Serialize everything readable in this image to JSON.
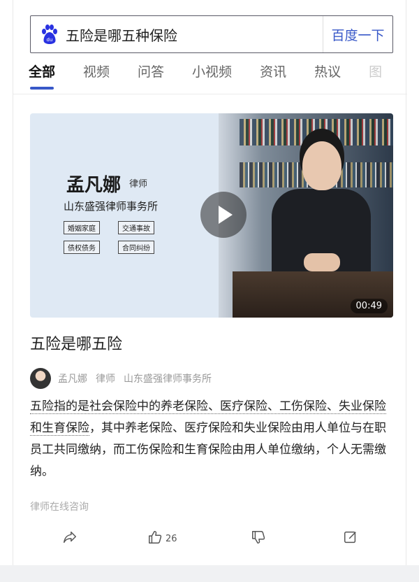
{
  "search": {
    "query": "五险是哪五种保险",
    "button_label": "百度一下"
  },
  "tabs": [
    {
      "label": "全部",
      "active": true
    },
    {
      "label": "视频"
    },
    {
      "label": "问答"
    },
    {
      "label": "小视频"
    },
    {
      "label": "资讯"
    },
    {
      "label": "热议"
    },
    {
      "label": "图"
    }
  ],
  "video": {
    "lawyer_name": "孟凡娜",
    "lawyer_role": "律师",
    "law_firm": "山东盛强律师事务所",
    "practice_tags": [
      "婚姻家庭",
      "交通事故",
      "债权债务",
      "合同纠纷"
    ],
    "duration": "00:49"
  },
  "result": {
    "title": "五险是哪五险",
    "author_name": "孟凡娜",
    "author_role": "律师",
    "author_firm": "山东盛强律师事务所",
    "body_highlight": "五险指的是社会保险中的养老保险、医疗保险、工伤保险、失业保险和生育保险",
    "body_rest": "，其中养老保险、医疗保险和失业保险由用人单位与在职员工共同缴纳，而工伤保险和生育保险由用人单位缴纳，个人无需缴纳。",
    "source": "律师在线咨询"
  },
  "actions": {
    "like_count": "26"
  },
  "icons": [
    "baidu-paw-icon",
    "play-icon",
    "share-icon",
    "thumbs-up-icon",
    "thumbs-down-icon",
    "edit-icon"
  ],
  "colors": {
    "accent": "#3858c8",
    "tab_underline": "#3858c8"
  }
}
